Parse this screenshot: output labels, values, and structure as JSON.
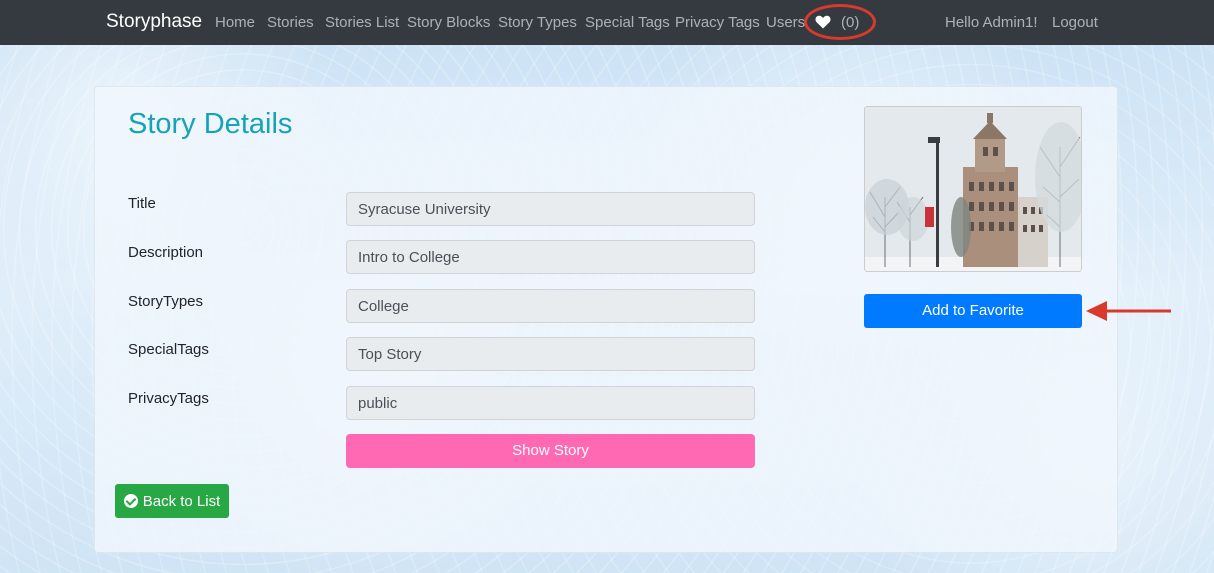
{
  "nav": {
    "brand": "Storyphase",
    "links": [
      "Home",
      "Stories",
      "Stories List",
      "Story Blocks",
      "Story Types",
      "Special Tags",
      "Privacy Tags",
      "Users"
    ],
    "favorites_count": "(0)",
    "greeting": "Hello Admin1!",
    "logout": "Logout"
  },
  "page": {
    "title": "Story Details"
  },
  "fields": [
    {
      "label": "Title",
      "value": "Syracuse University"
    },
    {
      "label": "Description",
      "value": "Intro to College"
    },
    {
      "label": "StoryTypes",
      "value": "College"
    },
    {
      "label": "SpecialTags",
      "value": "Top Story"
    },
    {
      "label": "PrivacyTags",
      "value": "public"
    }
  ],
  "buttons": {
    "show_story": "Show Story",
    "back_to_list": "Back to List",
    "add_to_favorite": "Add to Favorite"
  },
  "icons": {
    "heart": "heart-icon",
    "check": "check-circle-icon"
  },
  "colors": {
    "navbar": "#343a40",
    "title": "#17a2b8",
    "show_story": "#ff69b4",
    "back": "#28a745",
    "favorite": "#007bff",
    "annotation": "#d93a2b"
  }
}
